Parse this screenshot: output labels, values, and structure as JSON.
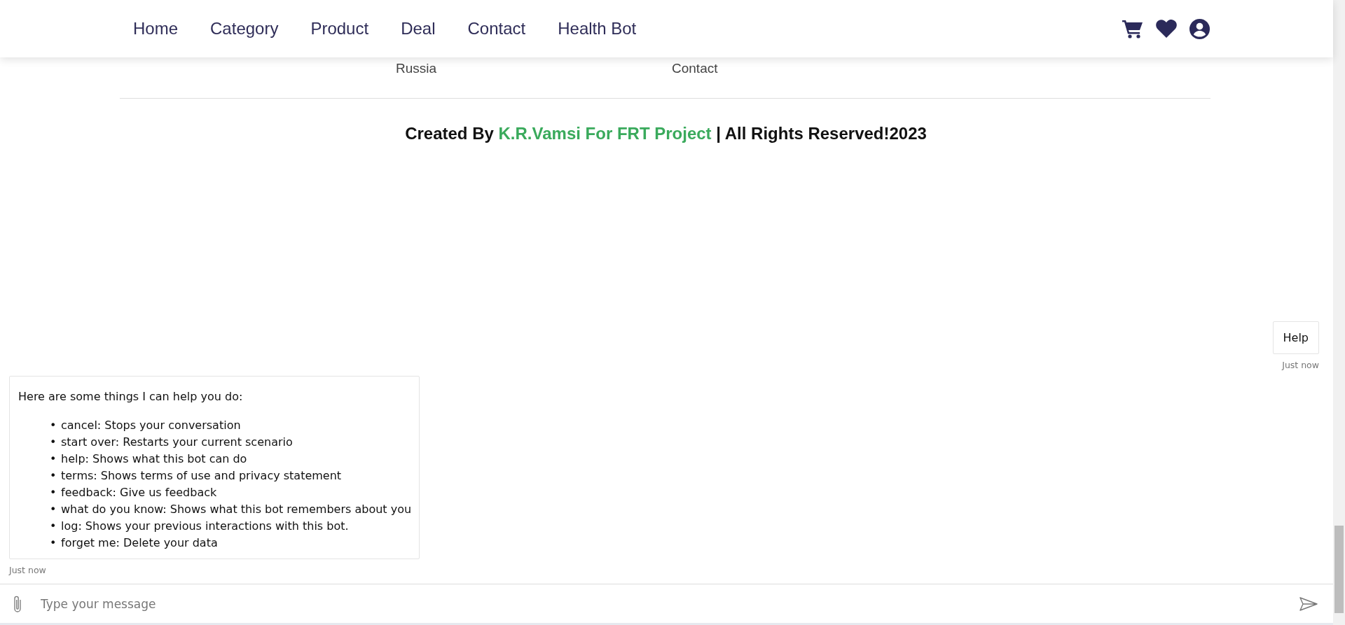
{
  "nav": {
    "links": [
      {
        "label": "Home"
      },
      {
        "label": "Category"
      },
      {
        "label": "Product"
      },
      {
        "label": "Deal"
      },
      {
        "label": "Contact"
      },
      {
        "label": "Health Bot"
      }
    ]
  },
  "footer": {
    "columns": [
      "Russia",
      "Contact"
    ],
    "credit": "Created By **K.R.Vamsi For FRT Project** | All Rights Reserved!2023"
  },
  "chat": {
    "messages": [
      {
        "kind": "user",
        "text": "Help",
        "time": "Just now"
      },
      {
        "kind": "bot",
        "intro": "Here are some things I can help you do:",
        "marker": "•",
        "items": [
          "cancel: Stops your conversation",
          "start over: Restarts your current scenario",
          "help: Shows what this bot can do",
          "terms: Shows terms of use and privacy statement",
          "feedback: Give us feedback",
          "what do you know: Shows what this bot remembers about you",
          "log: Shows your previous interactions with this bot.",
          "forget me: Delete your data"
        ],
        "time": "Just now"
      }
    ],
    "input": {
      "placeholder": "Type your message"
    }
  }
}
